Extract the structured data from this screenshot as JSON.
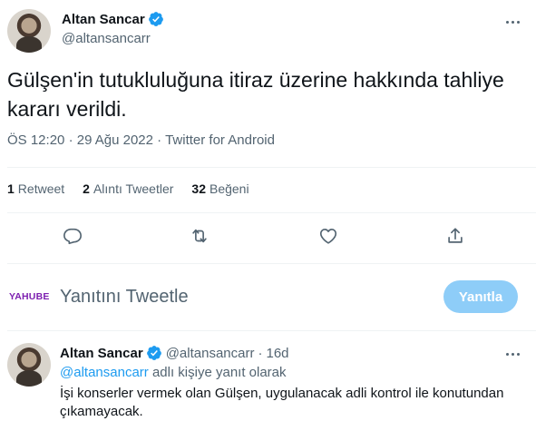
{
  "tweet": {
    "display_name": "Altan Sancar",
    "handle": "@altansancarr",
    "text": "Gülşen'in tutukluluğuna itiraz üzerine  hakkında tahliye kararı verildi.",
    "time": "ÖS 12:20",
    "separator": "·",
    "date": "29 Ağu 2022",
    "client": "Twitter for Android",
    "stats": {
      "retweets_count": "1",
      "retweets_label": "Retweet",
      "quotes_count": "2",
      "quotes_label": "Alıntı Tweetler",
      "likes_count": "32",
      "likes_label": "Beğeni"
    }
  },
  "reply_box": {
    "avatar_text": "YAHUBE",
    "placeholder": "Yanıtını Tweetle",
    "button_label": "Yanıtla"
  },
  "reply": {
    "display_name": "Altan Sancar",
    "handle": "@altansancarr",
    "age": "16d",
    "separator": "·",
    "replying_to_mention": "@altansancarr",
    "replying_to_suffix": "adlı kişiye yanıt olarak",
    "text": "İşi konserler vermek olan Gülşen, uygulanacak adli kontrol ile konutundan çıkamayacak."
  },
  "colors": {
    "accent": "#1d9bf0",
    "reply_button_disabled": "#8ecdf8",
    "secondary_text": "#536471",
    "primary_text": "#0f1419",
    "yahube_brand": "#7d1fb0"
  },
  "icons": [
    "verified-badge-icon",
    "more-icon",
    "reply-icon",
    "retweet-icon",
    "like-icon",
    "share-icon"
  ]
}
